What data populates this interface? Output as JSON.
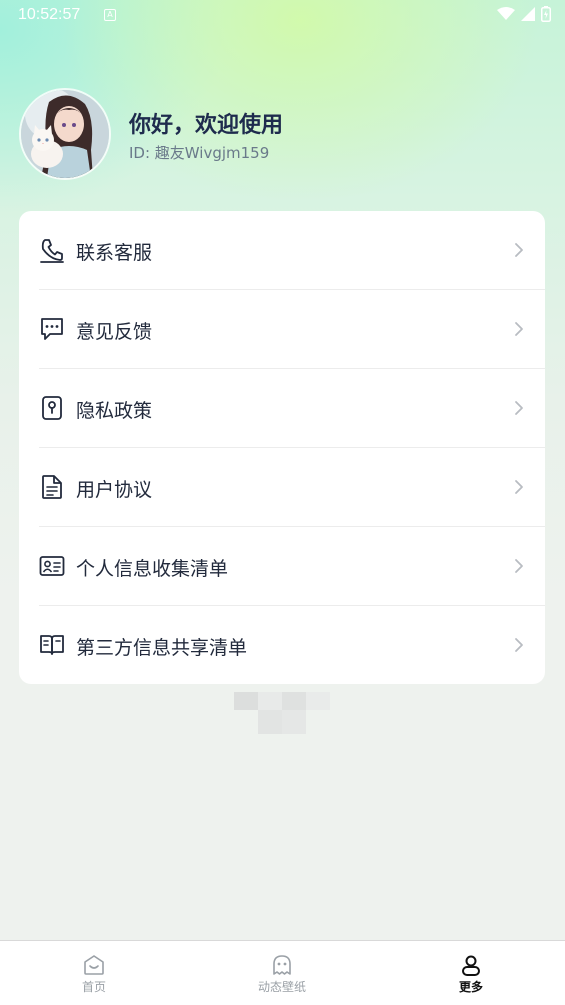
{
  "status_bar": {
    "time": "10:52:57",
    "notification_icon": "a-icon",
    "icons": [
      "wifi-icon",
      "signal-icon",
      "battery-icon"
    ]
  },
  "profile": {
    "greeting": "你好，欢迎使用",
    "user_id": "ID: 趣友Wivgjm159",
    "avatar": "avatar-girl-with-cat"
  },
  "menu": {
    "items": [
      {
        "label": "联系客服",
        "icon": "phone-icon"
      },
      {
        "label": "意见反馈",
        "icon": "chat-icon"
      },
      {
        "label": "隐私政策",
        "icon": "privacy-icon"
      },
      {
        "label": "用户协议",
        "icon": "document-icon"
      },
      {
        "label": "个人信息收集清单",
        "icon": "id-card-icon"
      },
      {
        "label": "第三方信息共享清单",
        "icon": "book-icon"
      }
    ]
  },
  "tabbar": {
    "tabs": [
      {
        "label": "首页",
        "icon": "home-icon",
        "active": false
      },
      {
        "label": "动态壁纸",
        "icon": "ghost-icon",
        "active": false
      },
      {
        "label": "更多",
        "icon": "user-icon",
        "active": true
      }
    ]
  },
  "colors": {
    "title": "#1e2b4d",
    "text": "#222a3c",
    "muted": "#9aa0a6",
    "background": "#eef2ee"
  }
}
